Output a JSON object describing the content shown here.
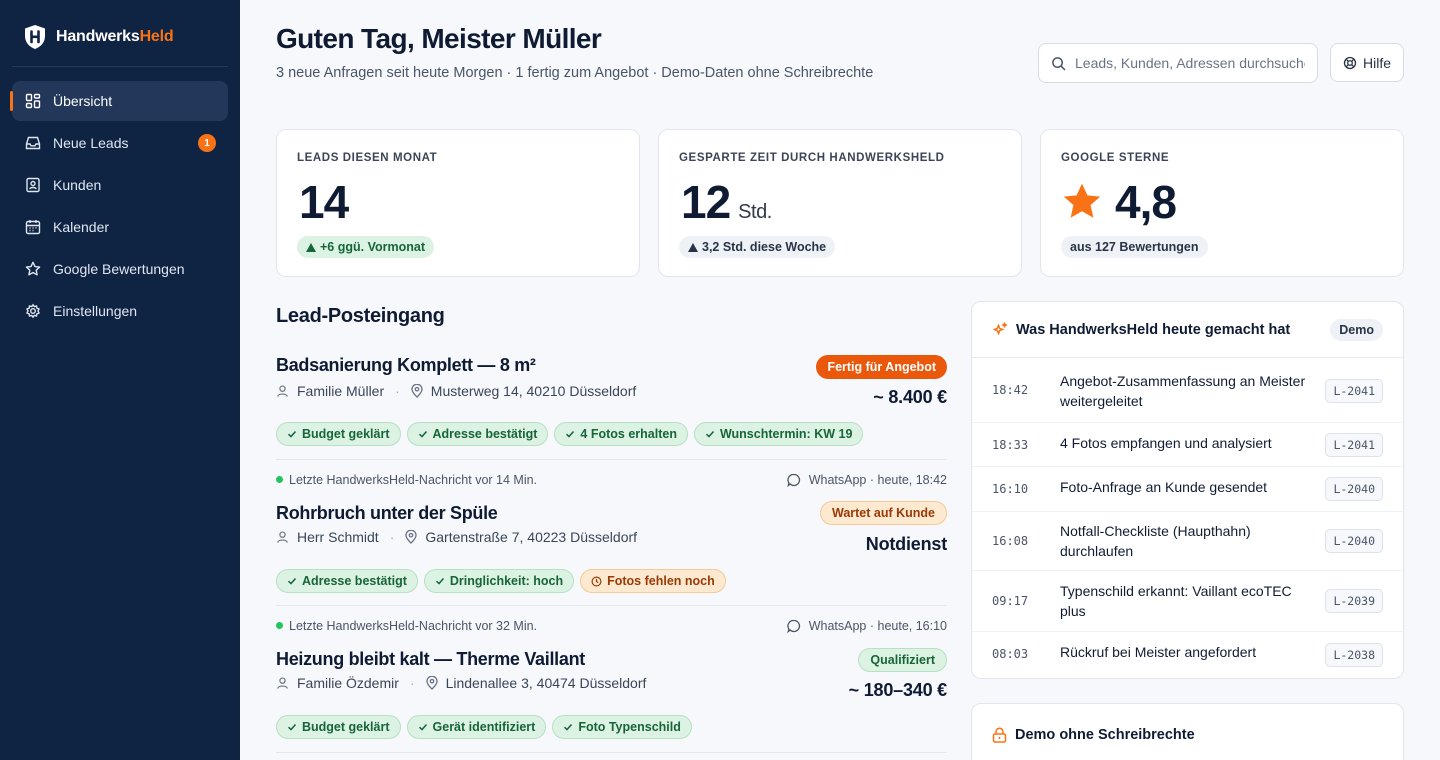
{
  "brand": {
    "name_main": "Handwerks",
    "name_accent": "Held"
  },
  "nav": [
    {
      "label": "Übersicht",
      "icon": "dashboard-icon",
      "active": true
    },
    {
      "label": "Neue Leads",
      "icon": "inbox-icon",
      "badge": "1"
    },
    {
      "label": "Kunden",
      "icon": "contacts-icon"
    },
    {
      "label": "Kalender",
      "icon": "calendar-icon"
    },
    {
      "label": "Google Bewertungen",
      "icon": "star-icon"
    },
    {
      "label": "Einstellungen",
      "icon": "gear-icon"
    }
  ],
  "header": {
    "title": "Guten Tag, Meister Müller",
    "subtitle": "3 neue Anfragen seit heute Morgen · 1 fertig zum Angebot · Demo-Daten ohne Schreibrechte",
    "search_placeholder": "Leads, Kunden, Adressen durchsuchen",
    "help_label": "Hilfe"
  },
  "stats": [
    {
      "label": "LEADS DIESEN MONAT",
      "value": "14",
      "unit": "",
      "badge": "+6 ggü. Vormonat"
    },
    {
      "label": "GESPARTE ZEIT DURCH HANDWERKSHELD",
      "value": "12",
      "unit": "Std.",
      "badge": "3,2 Std. diese Woche"
    },
    {
      "label": "GOOGLE STERNE",
      "value": "4,8",
      "unit": "",
      "badge": "aus 127 Bewertungen"
    }
  ],
  "inbox": {
    "title": "Lead-Posteingang",
    "leads": [
      {
        "title": "Badsanierung Komplett — 8 m²",
        "customer": "Familie Müller",
        "address": "Musterweg 14, 40210 Düsseldorf",
        "status": "Fertig für Angebot",
        "price": "~ 8.400 €",
        "tags": [
          "Budget geklärt",
          "Adresse bestätigt",
          "4 Fotos erhalten",
          "Wunschtermin: KW 19"
        ]
      },
      {
        "meta_text": "Letzte HandwerksHeld-Nachricht vor 14 Min.",
        "channel": "WhatsApp · heute, 18:42",
        "title": "Rohrbruch unter der Spüle",
        "customer": "Herr Schmidt",
        "address": "Gartenstraße 7, 40223 Düsseldorf",
        "status": "Wartet auf Kunde",
        "price": "Notdienst",
        "tags": [
          "Adresse bestätigt",
          "Dringlichkeit: hoch",
          "Fotos fehlen noch"
        ]
      },
      {
        "meta_text": "Letzte HandwerksHeld-Nachricht vor 32 Min.",
        "channel": "WhatsApp · heute, 16:10",
        "title": "Heizung bleibt kalt — Therme Vaillant",
        "customer": "Familie Özdemir",
        "address": "Lindenallee 3, 40474 Düsseldorf",
        "status": "Qualifiziert",
        "price": "~ 180–340 €",
        "tags": [
          "Budget geklärt",
          "Gerät identifiziert",
          "Foto Typenschild"
        ]
      }
    ]
  },
  "activity": {
    "title": "Was HandwerksHeld heute gemacht hat",
    "pill": "Demo",
    "rows": [
      {
        "time": "18:42",
        "text": "Angebot-Zusammenfassung an Meister weitergeleitet",
        "id": "L-2041"
      },
      {
        "time": "18:33",
        "text": "4 Fotos empfangen und analysiert",
        "id": "L-2041"
      },
      {
        "time": "16:10",
        "text": "Foto-Anfrage an Kunde gesendet",
        "id": "L-2040"
      },
      {
        "time": "16:08",
        "text": "Notfall-Checkliste (Haupthahn) durchlaufen",
        "id": "L-2040"
      },
      {
        "time": "09:17",
        "text": "Typenschild erkannt: Vaillant ecoTEC plus",
        "id": "L-2039"
      },
      {
        "time": "08:03",
        "text": "Rückruf bei Meister angefordert",
        "id": "L-2038"
      }
    ]
  },
  "demo_panel": {
    "title": "Demo ohne Schreibrechte"
  },
  "colors": {
    "sidebar": "#0f2342",
    "accent": "#f97316",
    "success": "#17653a",
    "warning": "#9a3a06"
  }
}
